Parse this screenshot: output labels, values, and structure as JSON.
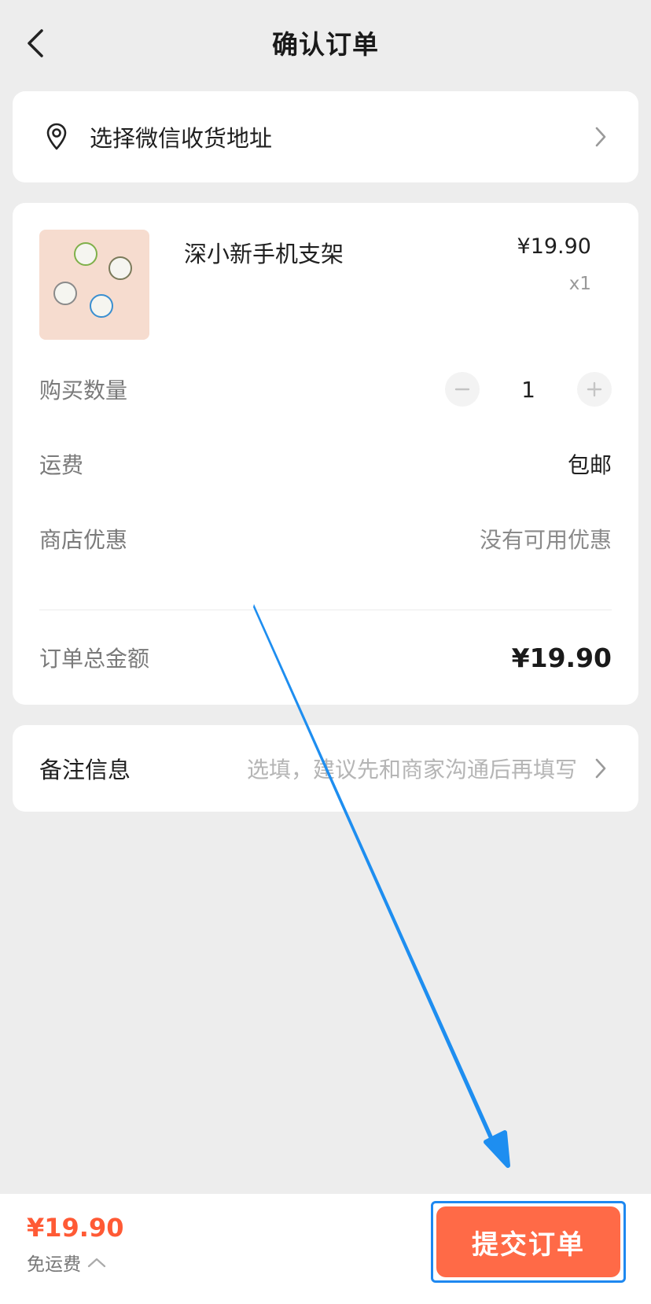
{
  "header": {
    "title": "确认订单"
  },
  "address": {
    "label": "选择微信收货地址"
  },
  "product": {
    "name": "深小新手机支架",
    "price": "¥19.90",
    "qty": "x1"
  },
  "order": {
    "quantity_label": "购买数量",
    "quantity_value": "1",
    "shipping_label": "运费",
    "shipping_value": "包邮",
    "discount_label": "商店优惠",
    "discount_value": "没有可用优惠",
    "total_label": "订单总金额",
    "total_value": "¥19.90"
  },
  "remark": {
    "label": "备注信息",
    "placeholder": "选填，建议先和商家沟通后再填写"
  },
  "bottom": {
    "total": "¥19.90",
    "shipping_note": "免运费",
    "submit_label": "提交订单"
  },
  "colors": {
    "accent": "#ff6a47",
    "price": "#ff5a35",
    "annotation": "#1e88f0"
  },
  "icons": [
    "back-arrow-icon",
    "location-pin-icon",
    "chevron-right-icon",
    "minus-icon",
    "plus-icon",
    "chevron-up-icon"
  ]
}
